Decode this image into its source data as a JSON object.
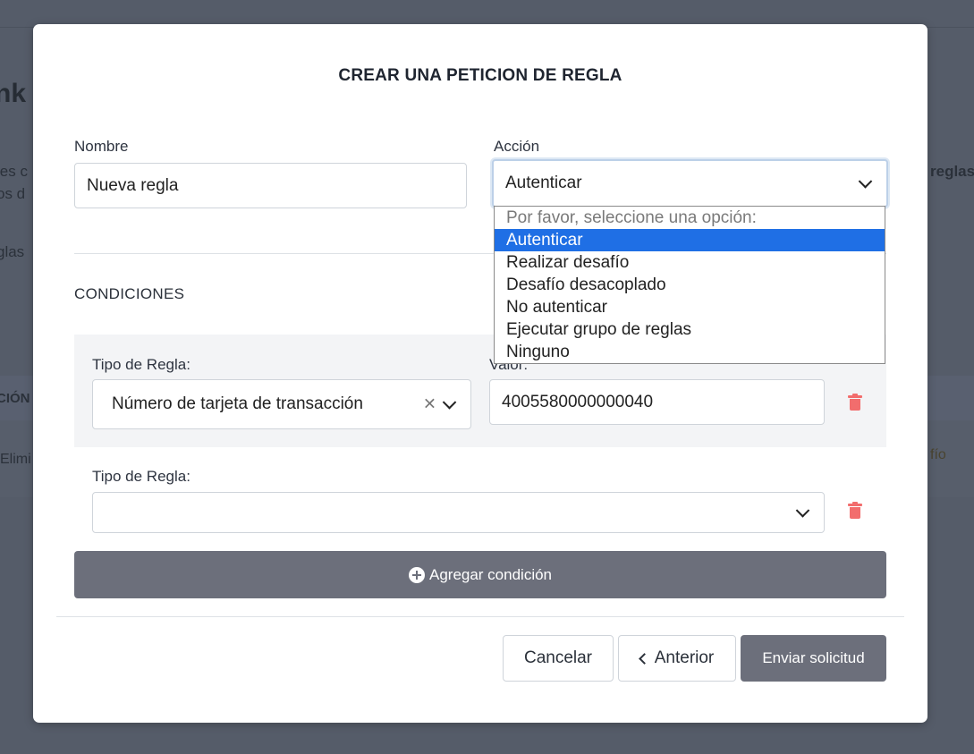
{
  "background": {
    "title_fragment": "nk T",
    "line1": "les c",
    "line2": "os d",
    "line3": "glas",
    "right_text": "reglas",
    "col_header": "CIÓN",
    "row_action": "Elimi",
    "row_right": "fío"
  },
  "modal": {
    "title": "CREAR UNA PETICION DE REGLA",
    "name_label": "Nombre",
    "name_value": "Nueva regla",
    "action_label": "Acción",
    "action_value": "Autenticar",
    "action_options": [
      "Por favor, seleccione una opción:",
      "Autenticar",
      "Realizar desafío",
      "Desafío desacoplado",
      "No autenticar",
      "Ejecutar grupo de reglas",
      "Ninguno"
    ],
    "conditions_title": "CONDICIONES",
    "conditions": [
      {
        "type_label": "Tipo de Regla:",
        "type_value": "Número de tarjeta de transacción",
        "value_label": "Valor:",
        "value": "4005580000000040"
      },
      {
        "type_label": "Tipo de Regla:",
        "type_value": ""
      }
    ],
    "add_condition_label": "Agregar condición",
    "cancel_label": "Cancelar",
    "previous_label": "Anterior",
    "submit_label": "Enviar solicitud"
  },
  "colors": {
    "overlay": "#555c69",
    "selected_option": "#1f6fe5",
    "delete_icon": "#f26d6d",
    "dark_button": "#6c6f7b"
  }
}
